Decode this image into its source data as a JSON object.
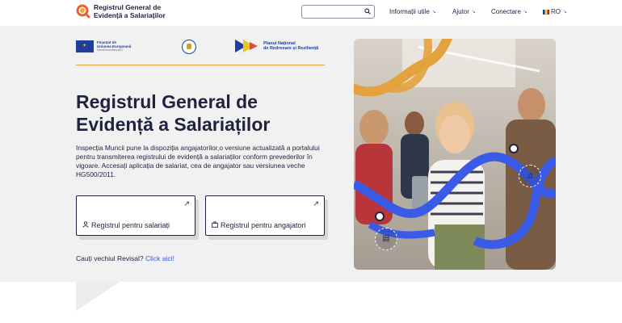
{
  "header": {
    "logo_line1": "Registrul General de",
    "logo_line2": "Evidență a Salariaților",
    "search_placeholder": "",
    "nav": [
      {
        "label": "Informații utile"
      },
      {
        "label": "Ajutor"
      },
      {
        "label": "Conectare"
      }
    ],
    "lang": "RO"
  },
  "partners": {
    "eu_line1": "Finanțat de",
    "eu_line2": "Uniunea Europeană",
    "eu_line3": "NextGenerationEU",
    "pnrr_line1": "Planul Național",
    "pnrr_line2": "de Redresare și Reziliență"
  },
  "hero": {
    "title_line1": "Registrul General de",
    "title_line2": "Evidență a Salariaților",
    "description": "Inspecția Muncii pune la dispoziția angajatorilor,o versiune actualizată a portalului pentru transmiterea registrului de evidență a salariaților conform prevederilor în vigoare. Accesați aplicația de salariat, cea de angajator sau versiunea veche HG500/2011.",
    "card_employee": "Registrul pentru salariați",
    "card_employer": "Registrul pentru angajatori",
    "revisal_text": "Cauți vechiul Revisal?",
    "revisal_link": "Click aici!"
  },
  "colors": {
    "navy": "#1f2340",
    "accent_blue": "#3a56d6",
    "accent_orange": "#e3a23d",
    "hero_bg": "#f1f1f2"
  },
  "icons": [
    "search-icon",
    "chevron-down-icon",
    "arrow-up-right-icon",
    "user-icon",
    "briefcase-icon",
    "music-note-icon",
    "book-icon"
  ]
}
